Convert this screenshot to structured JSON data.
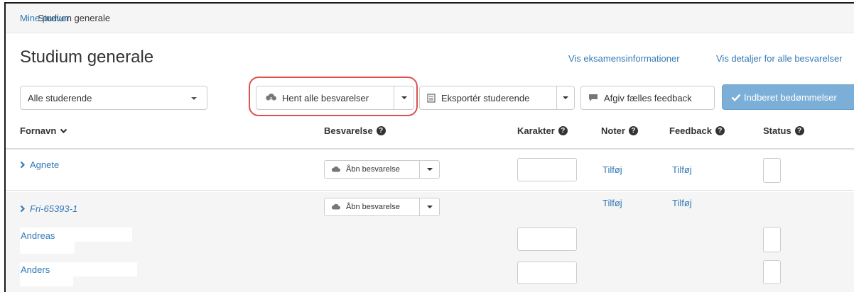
{
  "breadcrumb": {
    "root": "Mine prøver",
    "separator": "/",
    "current": "Studium generale"
  },
  "page_title": "Studium generale",
  "top_links": {
    "exam_info": "Vis eksamensinformationer",
    "all_details": "Vis detaljer for alle besvarelser"
  },
  "toolbar": {
    "student_filter": "Alle studerende",
    "fetch_all": "Hent alle besvarelser",
    "export_students": "Eksportér studerende",
    "common_feedback": "Afgiv fælles feedback",
    "submit_grades": "Indberet bedømmelser"
  },
  "columns": {
    "first_name": "Fornavn",
    "submission": "Besvarelse",
    "grade": "Karakter",
    "notes": "Noter",
    "feedback": "Feedback",
    "status": "Status"
  },
  "rows": [
    {
      "name": "Agnete",
      "open_label": "Åbn besvarelse",
      "notes": "Tilføj",
      "feedback": "Tilføj"
    },
    {
      "name": "Fri-65393-1",
      "open_label": "Åbn besvarelse",
      "notes": "Tilføj",
      "feedback": "Tilføj",
      "members": [
        {
          "name": "Andreas"
        },
        {
          "name": "Anders"
        }
      ]
    }
  ],
  "colors": {
    "link": "#337ab7",
    "primary": "#7cafd8",
    "highlight": "#d9534f"
  },
  "icons": {
    "cloud_download": "cloud-download-icon",
    "spreadsheet": "spreadsheet-icon",
    "comment": "comment-icon",
    "checkmark": "checkmark-icon",
    "chevron_down": "chevron-down-icon",
    "chevron_right": "chevron-right-icon",
    "question": "question-icon",
    "cloud": "cloud-icon"
  }
}
